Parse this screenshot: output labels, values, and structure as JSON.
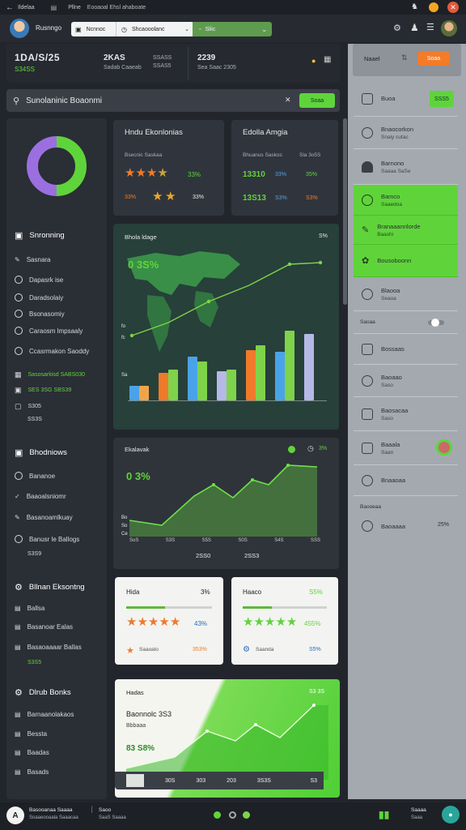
{
  "topbar": {
    "back_icon": "arrow-left-icon",
    "tab_label": "Ildelaa",
    "tab2_label": "Pllne",
    "tab2_sub": "Eooaoal Ehsl ahaboate"
  },
  "header": {
    "user_name": "Rusnngo",
    "select1": "Ncnnoc",
    "select2": "Shcaooolanc",
    "select3": "Sliic"
  },
  "stats": {
    "main_value": "1DA/S/25",
    "main_sub": "S34SS",
    "s2_value": "2KAS",
    "s2_sub": "Sadab Caaeab",
    "s3_value": "SSASS",
    "s3_sub": "SSAS5",
    "s4_value": "2239",
    "s4_sub": "Sea Saac 2305"
  },
  "search": {
    "placeholder": "Sunolaninic Boaonmi",
    "button": "Soaa"
  },
  "sidebar": {
    "section1": "Snronning",
    "items1": [
      "Sasnara",
      "Dapasrk ise",
      "Daradsolaiy",
      "Bsonasomiy",
      "Caraosm lmpsaaly",
      "Ccasrmakon Saoddy"
    ],
    "highlight_row": "Sasosarkisd  SABS030",
    "highlight_row2": "SES 3SG SBS39",
    "small_value": "S305",
    "small_value2": "SS3S",
    "section2": "Bhodniows",
    "items2": [
      "Bananoe",
      "Baaoalsniomr",
      "Basanoamlkuay",
      "Banusr le Ballogs"
    ],
    "items2_value": "S3S9",
    "section3": "Bllnan Eksontng",
    "items3": [
      "Ballsa",
      "Basanoar Ealas",
      "Basaoaaaar Ballas"
    ],
    "items3_value": "S3S5",
    "section4": "Dlrub Bonks",
    "items4": [
      "Barnaanolakaos",
      "Bessta",
      "Baadas",
      "Basads"
    ]
  },
  "donut": {
    "green_fraction": 0.5,
    "purple_fraction": 0.5,
    "green_color": "#5fd43a",
    "purple_color": "#9b6fe0"
  },
  "rating_card1": {
    "title": "Hndu Ekonlonias",
    "sub": "Bsecnic Saskaa",
    "row1_pct": "33%",
    "row2_pct": "33%",
    "row2_right": "33%"
  },
  "rating_card2": {
    "title": "Edolla Amgia",
    "sub_left": "Bhuanus Saskos",
    "sub_right": "Sla 3o5S",
    "row1_value": "13310",
    "row1_mid": "33%",
    "row1_right": "35%",
    "row2_left": "13S13",
    "row2_mid": "S3%",
    "row2_right": "S3%"
  },
  "map_card": {
    "title": "Bhola ldage",
    "corner": "S%",
    "overlay_value": "0 3S%",
    "y_labels": [
      "fo",
      "fc",
      "Sa"
    ]
  },
  "area_card": {
    "title": "Ekalavak",
    "value": "0 3%",
    "corner_pct": "3%",
    "x_labels": [
      "SoS",
      "S3S",
      "S5S",
      "S0S",
      "S4S",
      "SSS"
    ],
    "y_labels": [
      "Bo",
      "So",
      "Ce"
    ],
    "footer1": "2SS0",
    "footer2": "2SS3"
  },
  "review1": {
    "title": "Hida",
    "pct": "3%",
    "progress": 0.45,
    "stars_value": "43%",
    "small_label": "Saaoalo",
    "small_value": "353%"
  },
  "review2": {
    "title": "Haaco",
    "pct": "S5%",
    "progress": 0.35,
    "stars_value": "455%",
    "small_label": "Saanda",
    "small_value": "S5%"
  },
  "green_card": {
    "title": "Hadas",
    "corner": "S3  3S",
    "line1": "Baonnolc 3S3",
    "line2": "Bbbaaa",
    "value": "83 S8%",
    "footer": [
      "30S",
      "303",
      "203",
      "3S3S",
      "3S3S"
    ],
    "footer_right": "S3"
  },
  "right_panel": {
    "header_label": "Naael",
    "header_button": "Soaa",
    "item_top": "Buoa",
    "item_top_badge": "SSS5",
    "items": [
      {
        "label": "Bnaocorkon",
        "sub": "Snaiy cutac"
      },
      {
        "label": "Barnono",
        "sub": "Saaaa SaSe"
      },
      {
        "label": "Bamco",
        "sub": "Saaedoa"
      },
      {
        "label": "Branaaannlorde",
        "sub": "Baashi"
      },
      {
        "label": "Bousoboonn",
        "sub": ""
      },
      {
        "label": "Blaooa",
        "sub": "Seaoa"
      }
    ],
    "toggle_label": "Saoaa",
    "items2": [
      {
        "label": "Bossaas",
        "sub": ""
      },
      {
        "label": "Baoaao",
        "sub": "Saso"
      },
      {
        "label": "Baosacaa",
        "sub": "Saso"
      },
      {
        "label": "Baaala",
        "sub": "Saan"
      },
      {
        "label": "Bnaaoaa",
        "sub": ""
      }
    ],
    "footer_label": "Baooeaa",
    "footer_item": "Baoaaaa",
    "footer_pct": "25%"
  },
  "bottombar": {
    "left_label": "Basooanaa Saaaa",
    "left_sub": "Soaaeooaala Saaacaa",
    "mid_label": "Saoo",
    "mid_sub": "SaaS Saaaa",
    "right_label": "Saaaa",
    "right_sub": "Saaa"
  },
  "colors": {
    "accent_green": "#5fd43a",
    "orange": "#f07a2a",
    "blue": "#4aa3e8",
    "purple": "#9b6fe0",
    "panel": "#2c3138",
    "bg": "#22262c",
    "right_panel": "#a4a9b0"
  }
}
